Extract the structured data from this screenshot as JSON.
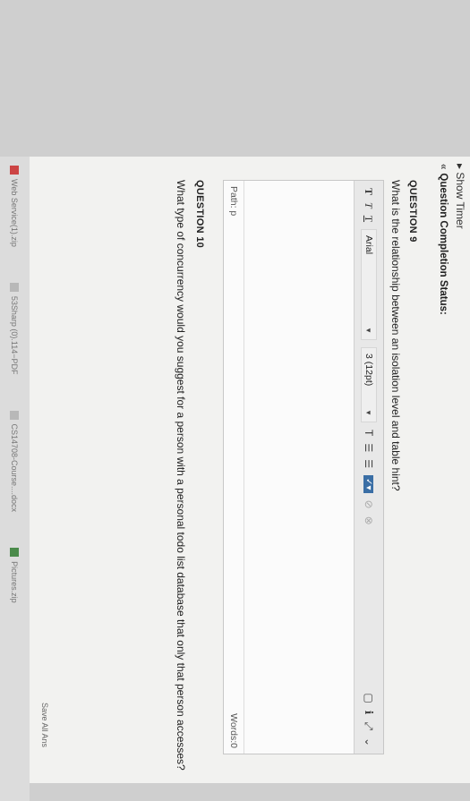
{
  "header": {
    "timer_label": "Show Timer",
    "completion_label": "Question Completion Status:"
  },
  "question9": {
    "title": "QUESTION 9",
    "text": "What is the relationship between an isolation level and table hint?",
    "toolbar": {
      "bold": "T",
      "italic": "T",
      "underline": "T",
      "font": "Arial",
      "size": "3 (12pt)",
      "text_color": "T",
      "list1": "☰",
      "list2": "☰"
    },
    "path_label": "Path: p",
    "words_label": "Words:0"
  },
  "question10": {
    "title": "QUESTION 10",
    "text": "What type of concurrency would you suggest for a person with a personal todo list database that only that person accesses?"
  },
  "footer": {
    "save_label": "Save All Ans"
  },
  "taskbar": {
    "items": [
      "Web Service(1).zip",
      "53Sharp (0).114−PDF",
      "CS14708-Course....docx",
      "Pictures.zip"
    ]
  }
}
